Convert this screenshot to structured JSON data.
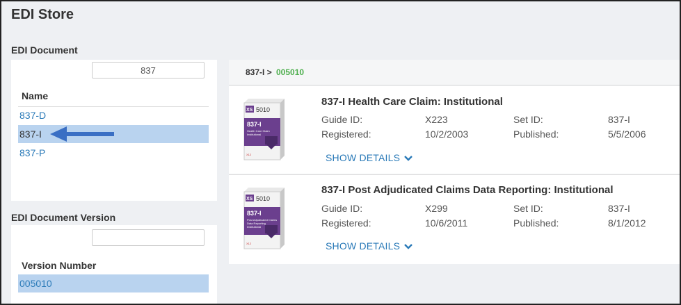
{
  "page": {
    "title": "EDI Store"
  },
  "doc_section": {
    "label": "EDI Document",
    "search_value": "837",
    "column_header": "Name",
    "items": [
      {
        "label": "837-D"
      },
      {
        "label": "837-I"
      },
      {
        "label": "837-P"
      }
    ],
    "selected_index": 1
  },
  "version_section": {
    "label": "EDI Document Version",
    "search_value": "",
    "column_header": "Version Number",
    "items": [
      {
        "label": "005010"
      }
    ]
  },
  "breadcrumb": {
    "first": "837-I",
    "separator": ">",
    "second": "005010"
  },
  "results": [
    {
      "title": "837-I Health Care Claim: Institutional",
      "guide_id_label": "Guide ID:",
      "guide_id": "X223",
      "set_id_label": "Set ID:",
      "set_id": "837-I",
      "registered_label": "Registered:",
      "registered": "10/2/2003",
      "published_label": "Published:",
      "published": "5/5/2006",
      "show_details": "SHOW DETAILS",
      "box": {
        "brand": "XS",
        "version": "5010",
        "code": "837-I",
        "subtitle_1": "Health Care Claim",
        "subtitle_2": "Institutional",
        "tag": "X12"
      }
    },
    {
      "title": "837-I Post Adjudicated Claims Data Reporting: Institutional",
      "guide_id_label": "Guide ID:",
      "guide_id": "X299",
      "set_id_label": "Set ID:",
      "set_id": "837-I",
      "registered_label": "Registered:",
      "registered": "10/6/2011",
      "published_label": "Published:",
      "published": "8/1/2012",
      "show_details": "SHOW DETAILS",
      "box": {
        "brand": "XS",
        "version": "5010",
        "code": "837-I",
        "subtitle_1": "Post Adjudicated Claims",
        "subtitle_2": "Data Reporting",
        "subtitle_3": "Institutional",
        "tag": "X12"
      }
    }
  ],
  "colors": {
    "link": "#2a7ab8",
    "selected_bg": "#b9d3ef",
    "breadcrumb_active": "#4cae4c",
    "arrow": "#3a6fc4",
    "box_purple": "#6b3f8e"
  }
}
